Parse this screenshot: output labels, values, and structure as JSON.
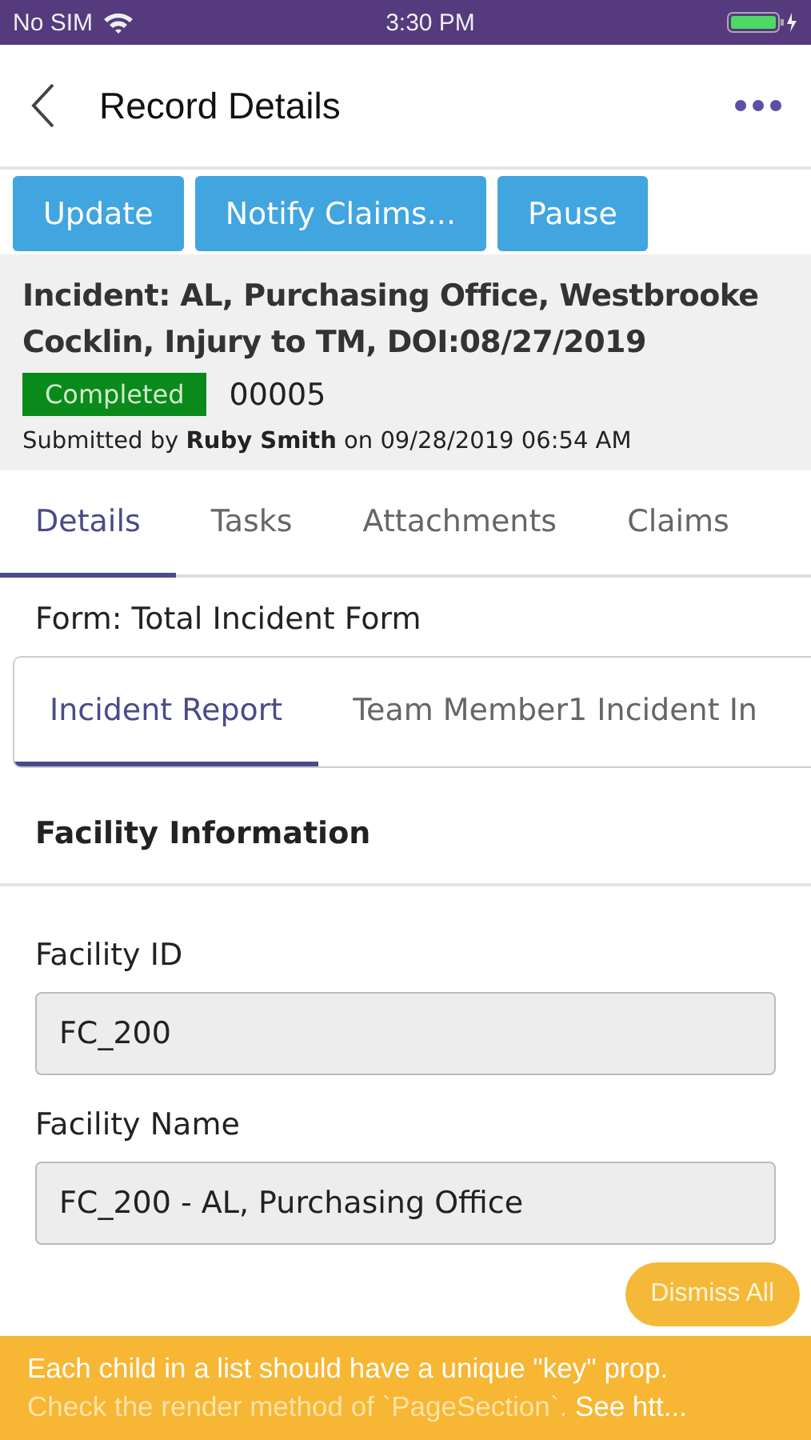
{
  "status_bar": {
    "carrier": "No SIM",
    "time": "3:30 PM"
  },
  "header": {
    "title": "Record Details"
  },
  "actions": [
    "Update",
    "Notify Claims...",
    "Pause"
  ],
  "record": {
    "title": "Incident: AL, Purchasing Office, Westbrooke Cocklin, Injury to TM, DOI:08/27/2019",
    "status": "Completed",
    "number": "00005",
    "submitted": "Submitted by **Ruby Smith** on 09/28/2019 06:54 AM"
  },
  "tabs": [
    {
      "label": "Details",
      "selected": true
    },
    {
      "label": "Tasks",
      "selected": false
    },
    {
      "label": "Attachments",
      "selected": false
    },
    {
      "label": "Claims",
      "selected": false
    }
  ],
  "form_name": "Form: Total Incident Form",
  "form_tabs": [
    {
      "label": "Incident Report",
      "selected": true
    },
    {
      "label": "Team Member1 Incident In",
      "selected": false
    }
  ],
  "section": {
    "title": "Facility Information"
  },
  "fields": [
    {
      "label": "Facility ID",
      "value": "FC_200"
    },
    {
      "label": "Facility Name",
      "value": "FC_200 - AL, Purchasing Office"
    }
  ],
  "toast": {
    "dismiss": "Dismiss All",
    "line_1": "Each child in a list should have a unique \"key\" prop.",
    "line_2": "Check the render method of `PageSection`.",
    "line_2_link": "See htt..."
  }
}
